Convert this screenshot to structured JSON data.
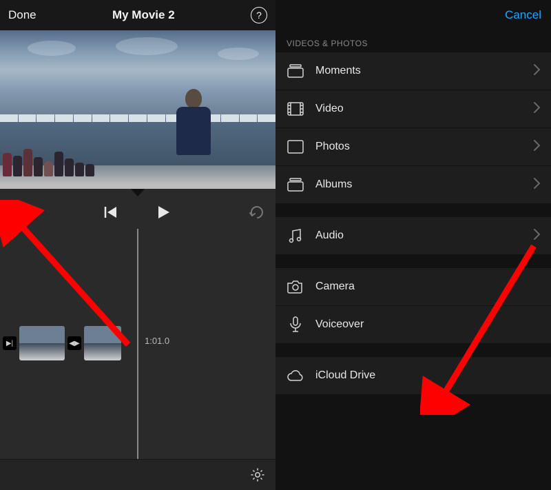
{
  "left": {
    "header": {
      "done": "Done",
      "title": "My Movie 2"
    },
    "timecode": "1:01.0"
  },
  "right": {
    "cancel": "Cancel",
    "section_label": "VIDEOS & PHOTOS",
    "group1": [
      {
        "label": "Moments",
        "icon": "moments-icon"
      },
      {
        "label": "Video",
        "icon": "video-icon"
      },
      {
        "label": "Photos",
        "icon": "photos-icon"
      },
      {
        "label": "Albums",
        "icon": "albums-icon"
      }
    ],
    "group2": [
      {
        "label": "Audio",
        "icon": "audio-icon"
      }
    ],
    "group3": [
      {
        "label": "Camera",
        "icon": "camera-icon"
      },
      {
        "label": "Voiceover",
        "icon": "microphone-icon"
      }
    ],
    "group4": [
      {
        "label": "iCloud Drive",
        "icon": "cloud-icon"
      }
    ]
  }
}
